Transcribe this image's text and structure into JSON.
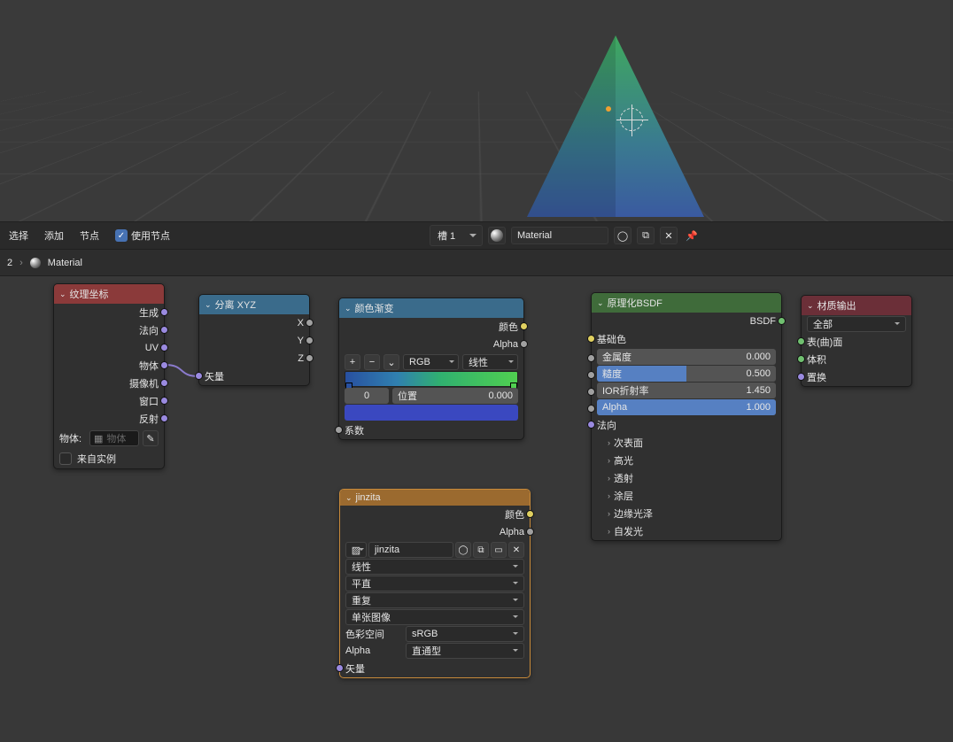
{
  "header": {
    "menus": [
      "选择",
      "添加",
      "节点"
    ],
    "use_nodes": "使用节点",
    "slot": "槽 1",
    "material_name": "Material"
  },
  "breadcrumb": {
    "item1": "2",
    "item2": "Material"
  },
  "nodes": {
    "texcoord": {
      "title": "纹理坐标",
      "outputs": [
        "生成",
        "法向",
        "UV",
        "物体",
        "摄像机",
        "窗口",
        "反射"
      ],
      "object_label": "物体:",
      "object_placeholder": "物体",
      "from_instancer": "来自实例"
    },
    "sepxyz": {
      "title": "分离 XYZ",
      "outputs": [
        "X",
        "Y",
        "Z"
      ],
      "input": "矢量"
    },
    "colorramp": {
      "title": "颜色渐变",
      "out_color": "颜色",
      "out_alpha": "Alpha",
      "mode": "RGB",
      "interp": "线性",
      "idx_label": "0",
      "pos_label": "位置",
      "pos_value": "0.000",
      "in_factor": "系数"
    },
    "jinzita": {
      "title": "jinzita",
      "out_color": "颜色",
      "out_alpha": "Alpha",
      "image_name": "jinzita",
      "interp": "线性",
      "proj": "平直",
      "ext": "重复",
      "source": "单张图像",
      "cs_label": "色彩空间",
      "cs_value": "sRGB",
      "alpha_label": "Alpha",
      "alpha_value": "直通型",
      "in_vector": "矢量"
    },
    "bsdf": {
      "title": "原理化BSDF",
      "out": "BSDF",
      "base_color": "基础色",
      "metallic": {
        "label": "金属度",
        "value": "0.000",
        "fill": 0
      },
      "roughness": {
        "label": "糙度",
        "value": "0.500",
        "fill": 50
      },
      "ior": {
        "label": "IOR折射率",
        "value": "1.450",
        "fill": 0
      },
      "alpha": {
        "label": "Alpha",
        "value": "1.000",
        "fill": 100
      },
      "normal": "法向",
      "collapsed": [
        "次表面",
        "高光",
        "透射",
        "涂层",
        "边缘光泽",
        "自发光"
      ]
    },
    "output": {
      "title": "材质输出",
      "target": "全部",
      "in_surface": "表(曲)面",
      "in_volume": "体积",
      "in_disp": "置换"
    }
  }
}
